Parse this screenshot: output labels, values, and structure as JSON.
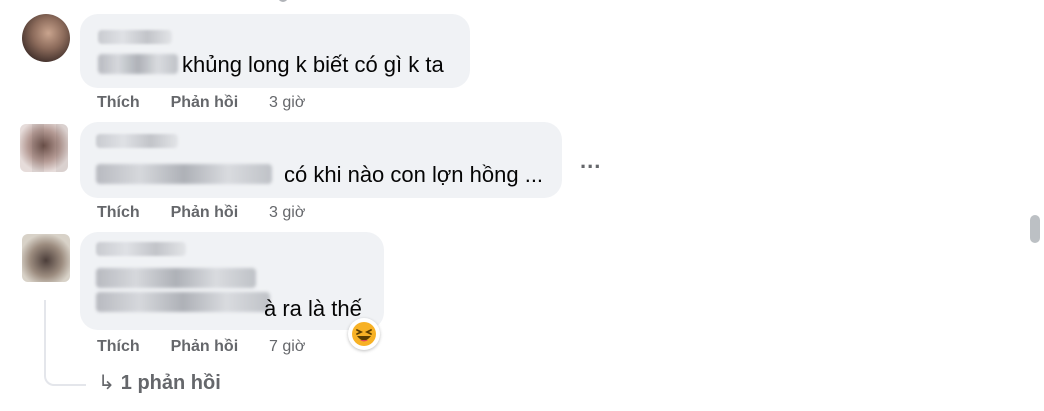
{
  "comments": [
    {
      "text": "khủng long k biết có gì k ta",
      "like_label": "Thích",
      "reply_label": "Phản hồi",
      "time": "3 giờ"
    },
    {
      "text": "có khi nào con lợn hồng ...",
      "like_label": "Thích",
      "reply_label": "Phản hồi",
      "time": "3 giờ"
    },
    {
      "text": "à ra là thế",
      "like_label": "Thích",
      "reply_label": "Phản hồi",
      "time": "7 giờ",
      "reaction": "laughing-emoji"
    }
  ],
  "more_options_label": "...",
  "replies_link": "1 phản hồi",
  "replies_arrow": "↳",
  "colors": {
    "bubble": "#f0f2f5",
    "secondary_text": "#65676b",
    "reaction_yellow": "#f7b125"
  }
}
